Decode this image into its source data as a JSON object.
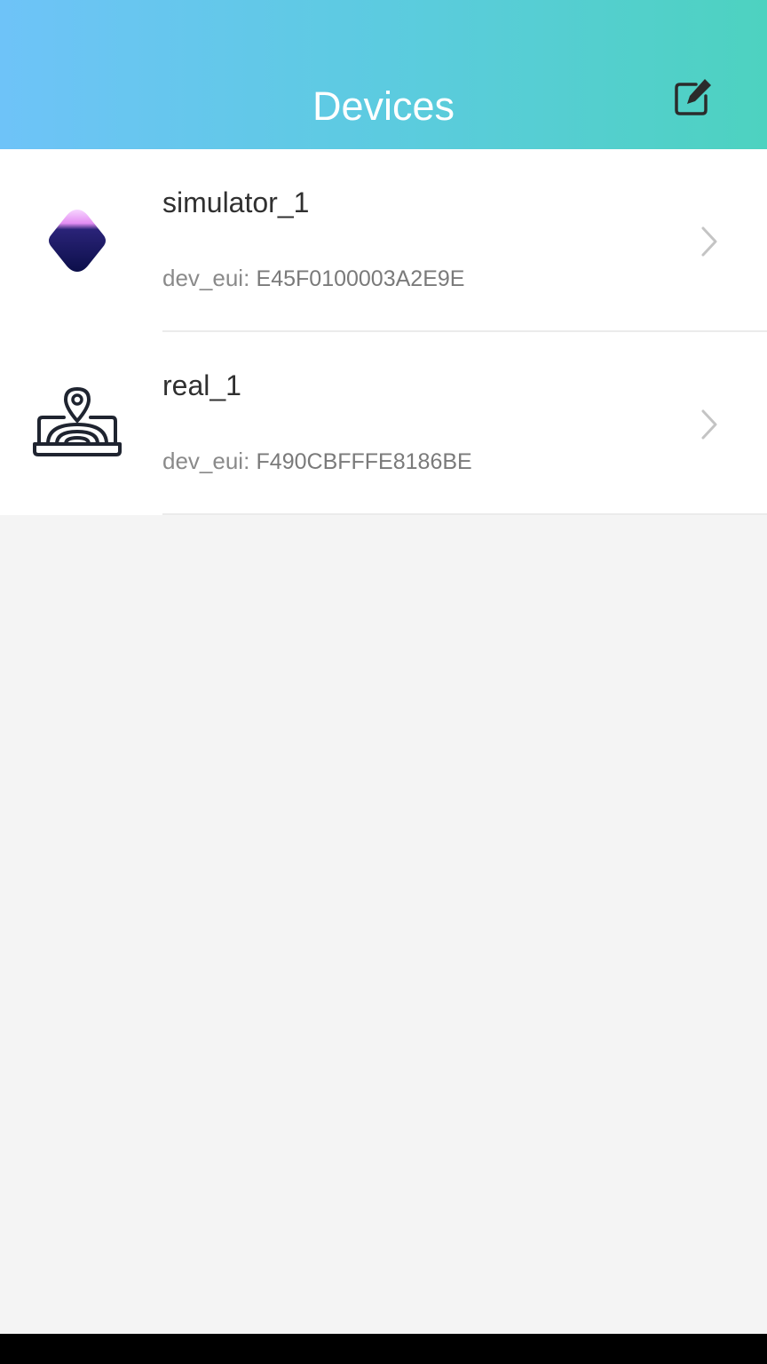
{
  "header": {
    "title": "Devices",
    "edit_icon": "edit-icon"
  },
  "devices": [
    {
      "name": "simulator_1",
      "eui_label": "dev_eui: ",
      "eui_value": "E45F0100003A2E9E",
      "icon": "simulator-device-icon"
    },
    {
      "name": "real_1",
      "eui_label": "dev_eui: ",
      "eui_value": "F490CBFFFE8186BE",
      "icon": "laptop-location-icon"
    }
  ],
  "colors": {
    "header_gradient_start": "#6ec3f8",
    "header_gradient_end": "#4dd2c0",
    "background": "#f4f4f4",
    "row_background": "#ffffff"
  }
}
